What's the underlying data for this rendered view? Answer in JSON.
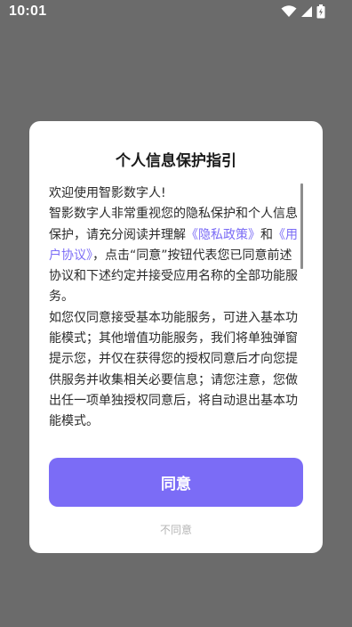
{
  "status_bar": {
    "time": "10:01",
    "icons": [
      "wifi-icon",
      "cellular-signal-icon",
      "battery-charging-icon"
    ]
  },
  "dialog": {
    "title": "个人信息保护指引",
    "body": {
      "greeting": "欢迎使用智影数字人!",
      "para1_before": "智影数字人非常重视您的隐私保护和个人信息保护，请充分阅读并理解",
      "privacy_link": "《隐私政策》",
      "and": "和",
      "user_agreement_link": "《用户协议》",
      "para1_after": "，点击“同意”按钮代表您已同意前述协议和下述约定并接受应用名称的全部功能服务。",
      "para2": "如您仅同意接受基本功能服务，可进入基本功能模式；其他增值功能服务，我们将单独弹窗提示您，并仅在获得您的授权同意后才向您提供服务并收集相关必要信息；请您注意，您做出任一项单独授权同意后，将自动退出基本功能模式。"
    },
    "agree_label": "同意",
    "disagree_label": "不同意"
  },
  "colors": {
    "accent": "#7b6cf6",
    "overlay": "#6b6b6b",
    "dialog_bg": "#ffffff"
  }
}
